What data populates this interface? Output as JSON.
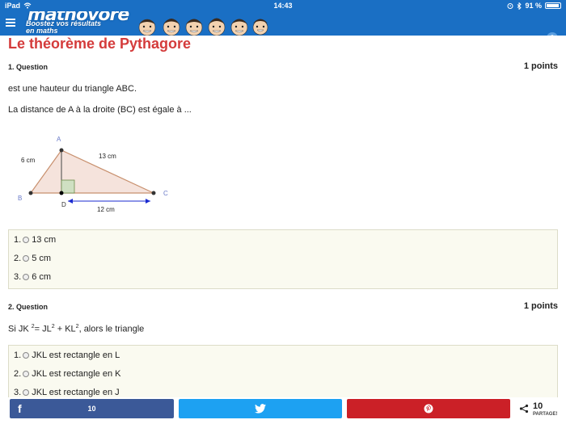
{
  "status_bar": {
    "device": "iPad",
    "time": "14:43",
    "battery": "91 %",
    "battery_level": 0.91
  },
  "app": {
    "brand": "mathovore",
    "tagline_1": "Boostez vos résultats",
    "tagline_2": "en maths",
    "header_color": "#1a6fc4"
  },
  "page": {
    "title": "Le théorème de Pythagore",
    "title_color": "#d43b3b"
  },
  "questions": [
    {
      "label": "1. Question",
      "points": "1 points",
      "text_1": "est une hauteur du triangle ABC.",
      "text_2": "La distance de A à la droite (BC) est égale à ...",
      "figure": {
        "points": [
          "A",
          "B",
          "C",
          "D"
        ],
        "labels": {
          "ab": "6 cm",
          "ac": "13 cm",
          "bc": "12 cm"
        }
      },
      "answers": [
        {
          "num": "1.",
          "text": "13 cm"
        },
        {
          "num": "2.",
          "text": "5 cm"
        },
        {
          "num": "3.",
          "text": "6 cm"
        }
      ]
    },
    {
      "label": "2. Question",
      "points": "1 points",
      "text_prefix": "Si JK",
      "text_sup1": "2",
      "text_mid": "= JL",
      "text_sup2": "2",
      "text_plus": " + KL",
      "text_sup3": "2",
      "text_suffix": ", alors le triangle",
      "answers": [
        {
          "num": "1.",
          "text": "JKL est rectangle en L"
        },
        {
          "num": "2.",
          "text": "JKL est rectangle en K"
        },
        {
          "num": "3.",
          "text": "JKL est rectangle en J"
        }
      ]
    }
  ],
  "share": {
    "facebook_count": "10",
    "total": "10",
    "total_label": "PARTAGE!",
    "colors": {
      "facebook": "#3b5998",
      "twitter": "#1da1f2",
      "pinterest": "#cb2027"
    }
  },
  "icons": [
    "menu-icon",
    "wifi-icon",
    "alarm-icon",
    "bluetooth-icon",
    "facebook-icon",
    "twitter-icon",
    "pinterest-icon",
    "share-icon"
  ]
}
